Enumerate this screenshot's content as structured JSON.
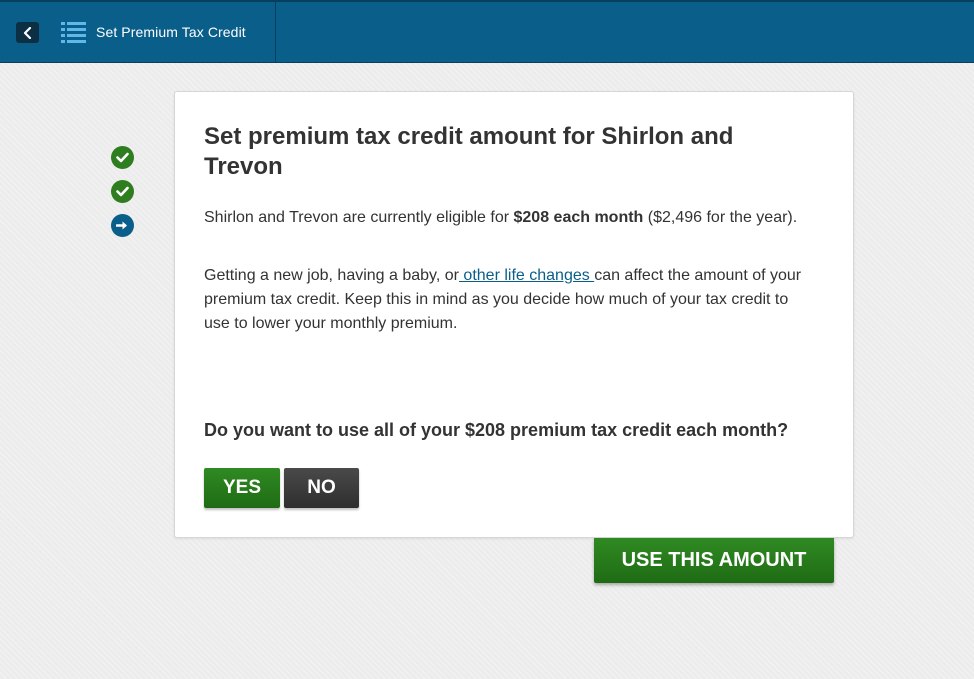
{
  "header": {
    "title": "Set Premium Tax Credit",
    "back_icon": "chevron-left-icon",
    "menu_icon": "list-icon"
  },
  "steps": [
    {
      "status": "complete",
      "icon": "check-circle-icon"
    },
    {
      "status": "complete",
      "icon": "check-circle-icon"
    },
    {
      "status": "current",
      "icon": "arrow-right-circle-icon"
    }
  ],
  "card": {
    "title": "Set premium tax credit amount for Shirlon and Trevon",
    "eligibility": {
      "prefix": "Shirlon and Trevon are currently eligible for ",
      "amount": "$208 each month",
      "suffix": " ($2,496 for the year)."
    },
    "info": {
      "prefix": "Getting a new job, having a baby, or",
      "link": " other life changes ",
      "suffix": "can affect the amount of your premium tax credit. Keep this in mind as you decide how much of your tax credit to use to lower your monthly premium."
    },
    "question": "Do you want to use all of your $208 premium tax credit each month?",
    "yes_label": "YES",
    "no_label": "NO"
  },
  "use_amount_label": "USE THIS AMOUNT",
  "colors": {
    "header_bg": "#0a5e8a",
    "primary_green": "#2e7d1e",
    "dark_button": "#3a3a3a",
    "link": "#0a5e8a"
  }
}
